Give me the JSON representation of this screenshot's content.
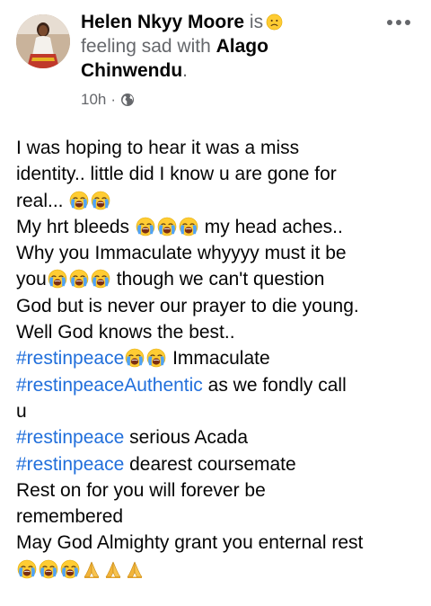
{
  "post": {
    "author_name": "Helen Nkyy Moore",
    "verb": "is",
    "feeling_text": "feeling sad with",
    "tagged_name": "Alago Chinwendu",
    "period": ".",
    "time": "10h",
    "dot": "·",
    "privacy_icon": "globe-icon",
    "more_icon": "more-options-icon"
  },
  "body": {
    "l1": "I was hoping to hear it was a miss",
    "l2": "identity.. little did I know u are gone for",
    "l3": "real...",
    "l4a": "My hrt bleeds",
    "l4b": "my head aches..",
    "l5": "Why you Immaculate whyyyy must it be",
    "l6a": "you",
    "l6b": "though we can't question",
    "l7": "God but is never our prayer to die young.",
    "l8": "Well God knows the best..",
    "tag1": "#restinpeace",
    "l9b": "Immaculate",
    "tag2": "#restinpeaceAuthentic",
    "l10b": "as we fondly call",
    "l11": "u",
    "tag3": "#restinpeace",
    "l12b": "serious Acada",
    "tag4": "#restinpeace",
    "l13b": "dearest coursemate",
    "l14": "Rest on for you will forever be",
    "l15": "remembered",
    "l16": "May God Almighty grant you enternal rest"
  },
  "emoji_names": {
    "crying": "loudly-crying-face-emoji",
    "prayer": "folded-hands-emoji",
    "sad": "sad-face-emoji"
  }
}
